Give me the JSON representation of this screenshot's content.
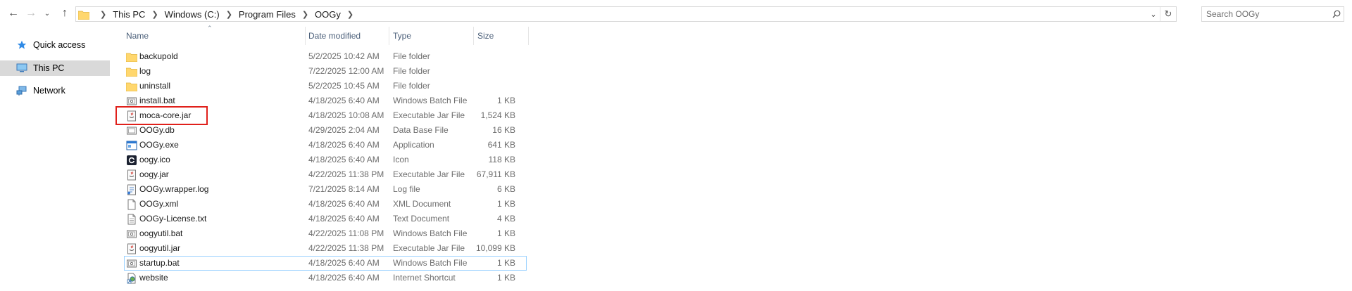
{
  "nav": {
    "back_icon": "arrow-left-icon",
    "forward_icon": "arrow-right-icon",
    "recent_icon": "chevron-down-icon",
    "up_icon": "arrow-up-icon"
  },
  "address": {
    "breadcrumbs": [
      "This PC",
      "Windows (C:)",
      "Program Files",
      "OOGy"
    ]
  },
  "search": {
    "placeholder": "Search OOGy"
  },
  "sidebar": {
    "items": [
      {
        "label": "Quick access",
        "icon": "star-icon"
      },
      {
        "label": "This PC",
        "icon": "computer-icon"
      },
      {
        "label": "Network",
        "icon": "network-icon"
      }
    ]
  },
  "columns": {
    "name": "Name",
    "date": "Date modified",
    "type": "Type",
    "size": "Size"
  },
  "files": [
    {
      "name": "backupold",
      "date": "5/2/2025 10:42 AM",
      "type": "File folder",
      "size": "",
      "icon": "folder-icon"
    },
    {
      "name": "log",
      "date": "7/22/2025 12:00 AM",
      "type": "File folder",
      "size": "",
      "icon": "folder-icon"
    },
    {
      "name": "uninstall",
      "date": "5/2/2025 10:45 AM",
      "type": "File folder",
      "size": "",
      "icon": "folder-icon"
    },
    {
      "name": "install.bat",
      "date": "4/18/2025 6:40 AM",
      "type": "Windows Batch File",
      "size": "1 KB",
      "icon": "batch-file-icon"
    },
    {
      "name": "moca-core.jar",
      "date": "4/18/2025 10:08 AM",
      "type": "Executable Jar File",
      "size": "1,524 KB",
      "icon": "jar-file-icon"
    },
    {
      "name": "OOGy.db",
      "date": "4/29/2025 2:04 AM",
      "type": "Data Base File",
      "size": "16 KB",
      "icon": "db-file-icon"
    },
    {
      "name": "OOGy.exe",
      "date": "4/18/2025 6:40 AM",
      "type": "Application",
      "size": "641 KB",
      "icon": "exe-icon"
    },
    {
      "name": "oogy.ico",
      "date": "4/18/2025 6:40 AM",
      "type": "Icon",
      "size": "118 KB",
      "icon": "ico-file-icon"
    },
    {
      "name": "oogy.jar",
      "date": "4/22/2025 11:38 PM",
      "type": "Executable Jar File",
      "size": "67,911 KB",
      "icon": "jar-file-icon"
    },
    {
      "name": "OOGy.wrapper.log",
      "date": "7/21/2025 8:14 AM",
      "type": "Log file",
      "size": "6 KB",
      "icon": "log-file-icon"
    },
    {
      "name": "OOGy.xml",
      "date": "4/18/2025 6:40 AM",
      "type": "XML Document",
      "size": "1 KB",
      "icon": "xml-file-icon"
    },
    {
      "name": "OOGy-License.txt",
      "date": "4/18/2025 6:40 AM",
      "type": "Text Document",
      "size": "4 KB",
      "icon": "text-file-icon"
    },
    {
      "name": "oogyutil.bat",
      "date": "4/22/2025 11:08 PM",
      "type": "Windows Batch File",
      "size": "1 KB",
      "icon": "batch-file-icon"
    },
    {
      "name": "oogyutil.jar",
      "date": "4/22/2025 11:38 PM",
      "type": "Executable Jar File",
      "size": "10,099 KB",
      "icon": "jar-file-icon"
    },
    {
      "name": "startup.bat",
      "date": "4/18/2025 6:40 AM",
      "type": "Windows Batch File",
      "size": "1 KB",
      "icon": "batch-file-icon"
    },
    {
      "name": "website",
      "date": "4/18/2025 6:40 AM",
      "type": "Internet Shortcut",
      "size": "1 KB",
      "icon": "shortcut-icon"
    }
  ],
  "colors": {
    "accent": "#0078d7",
    "selection": "#cce8ff",
    "highlight": "#e0201b",
    "folder": "#ffd76e"
  }
}
